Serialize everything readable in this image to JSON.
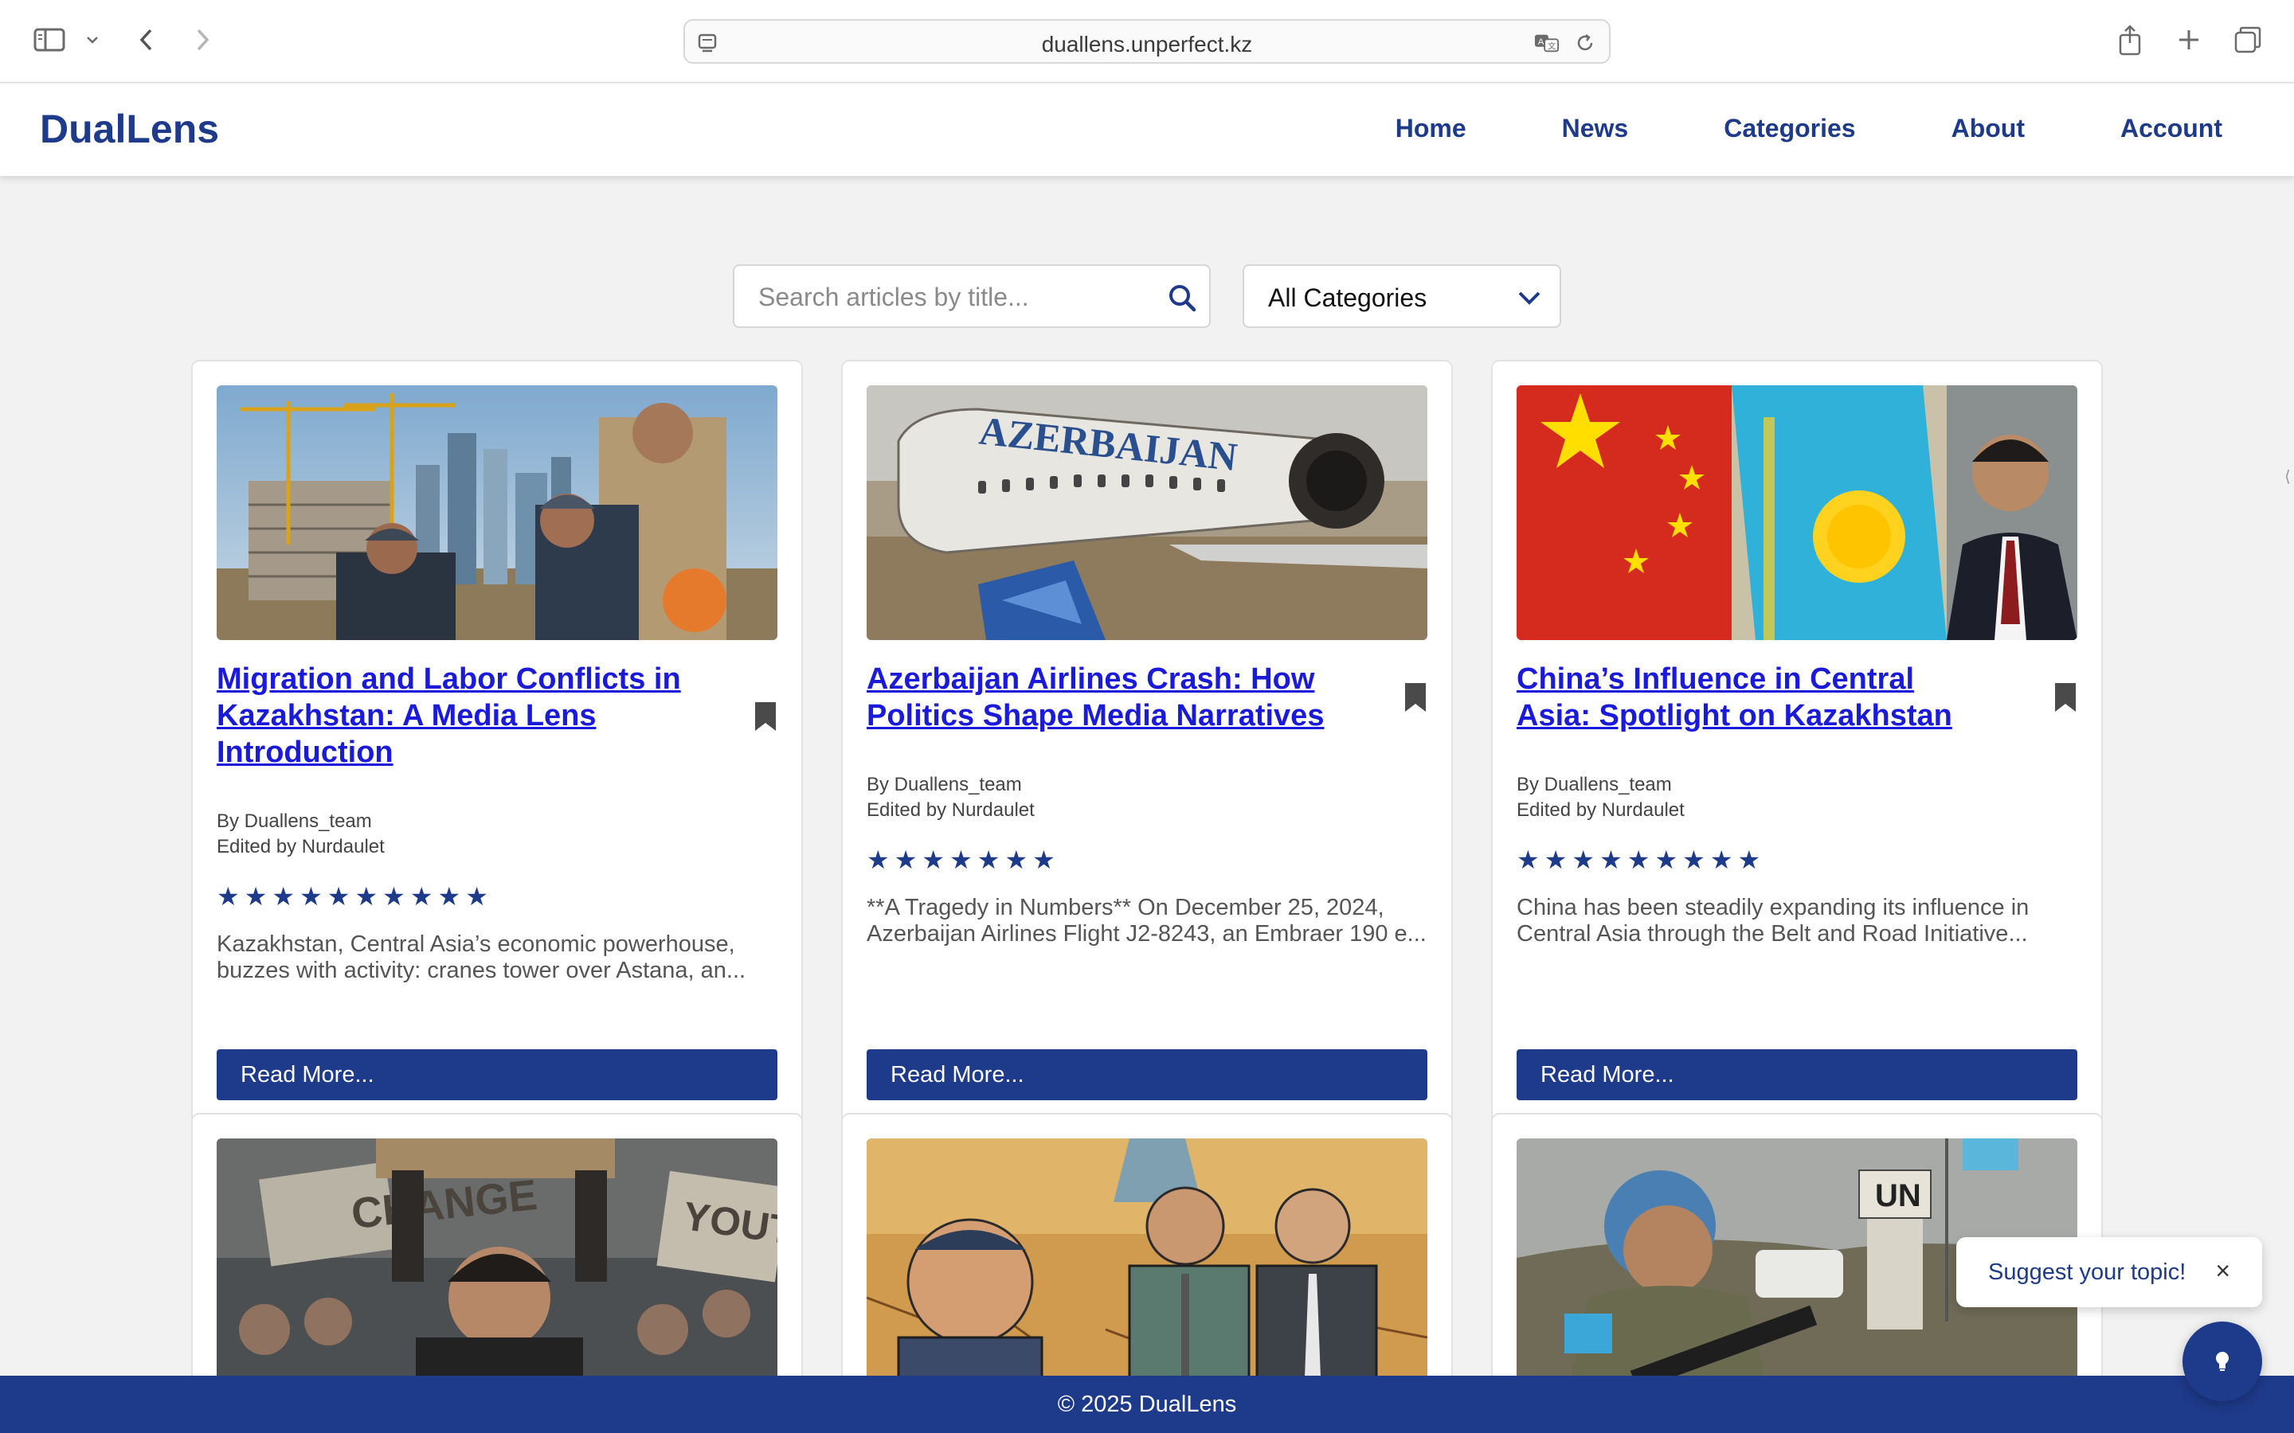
{
  "browser": {
    "url": "duallens.unperfect.kz"
  },
  "site": {
    "logo": "DualLens",
    "nav": [
      "Home",
      "News",
      "Categories",
      "About",
      "Account"
    ]
  },
  "filters": {
    "search_placeholder": "Search articles by title...",
    "category_selected": "All Categories"
  },
  "articles": [
    {
      "title": "Migration and Labor Conflicts in Kazakhstan: A Media Lens Introduction",
      "author": "By Duallens_team",
      "editor": "Edited by Nurdaulet",
      "rating": 10,
      "excerpt": "Kazakhstan, Central Asia’s economic powerhouse, buzzes with activity: cranes tower over Astana, an...",
      "button": "Read More...",
      "image": "construction-workers-photo"
    },
    {
      "title": "Azerbaijan Airlines Crash: How Politics Shape Media Narratives",
      "author": "By Duallens_team",
      "editor": "Edited by Nurdaulet",
      "rating": 7,
      "excerpt": "**A Tragedy in Numbers** On December 25, 2024, Azerbaijan Airlines Flight J2-8243, an Embraer 190 e...",
      "button": "Read More...",
      "image": "plane-wreck-photo",
      "image_text": "AZERBAIJAN"
    },
    {
      "title": "China’s Influence in Central Asia: Spotlight on Kazakhstan",
      "author": "By Duallens_team",
      "editor": "Edited by Nurdaulet",
      "rating": 9,
      "excerpt": "China has been steadily expanding its influence in Central Asia through the Belt and Road Initiative...",
      "button": "Read More...",
      "image": "flags-photo"
    }
  ],
  "more_articles": [
    {
      "image": "protest-photo",
      "image_text": [
        "CHANGE",
        "YOUTH"
      ]
    },
    {
      "image": "drought-illustration"
    },
    {
      "image": "peacekeeper-photo",
      "image_text": "UN"
    }
  ],
  "suggest": {
    "label": "Suggest your topic!",
    "close": "×"
  },
  "footer": {
    "text": "© 2025 DualLens"
  },
  "colors": {
    "brand": "#1e3a8a",
    "link": "#1a1adb",
    "background": "#f2f2f2"
  },
  "icons": [
    "sidebar-icon",
    "chevron-down-icon",
    "back-icon",
    "forward-icon",
    "page-icon",
    "translate-icon",
    "reload-icon",
    "share-icon",
    "plus-icon",
    "tabs-icon",
    "search-icon",
    "bookmark-icon",
    "star-icon",
    "lightbulb-icon",
    "close-icon"
  ]
}
